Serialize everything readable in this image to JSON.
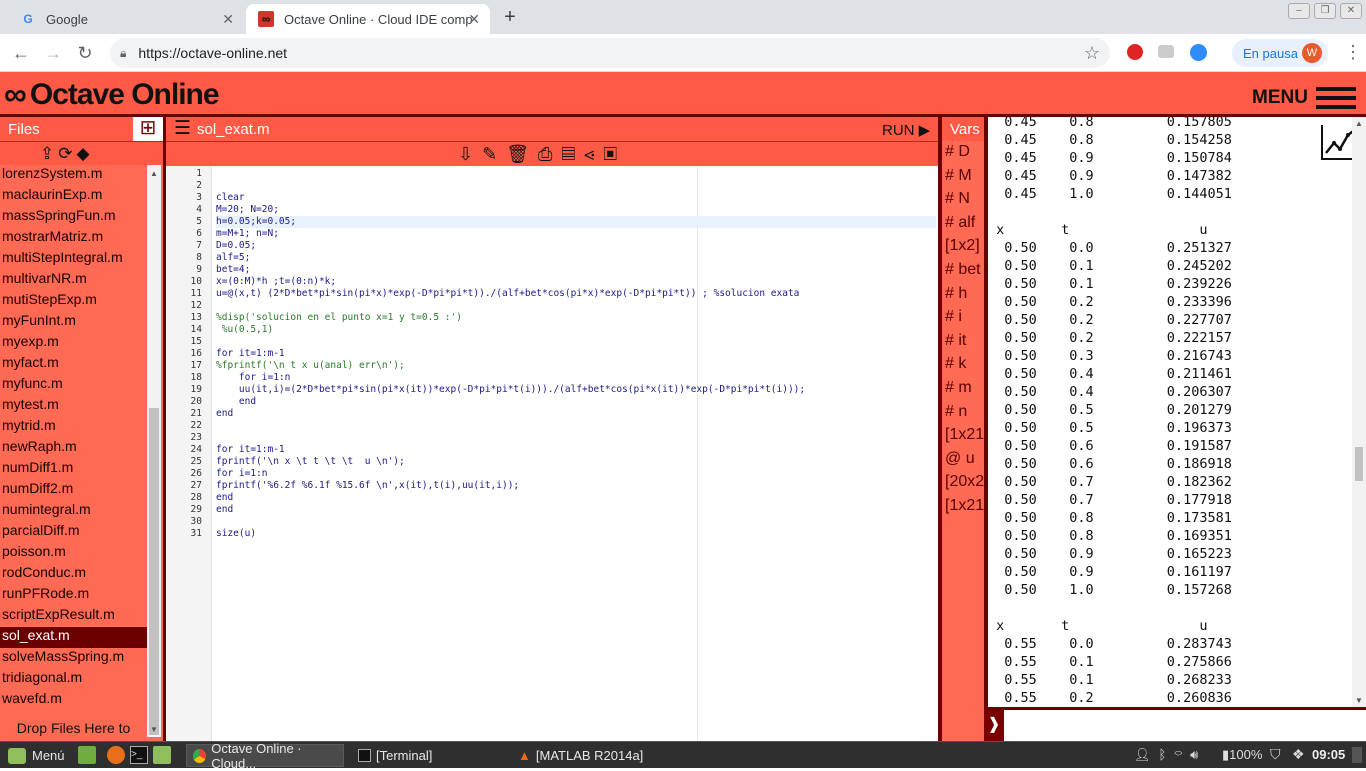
{
  "browser": {
    "tabs": [
      {
        "title": "Google",
        "icon": "google-icon"
      },
      {
        "title": "Octave Online · Cloud IDE comp",
        "icon": "octave-icon"
      }
    ],
    "url": "https://octave-online.net",
    "profile_status": "En pausa",
    "profile_initial": "W"
  },
  "app": {
    "logo": "Octave Online",
    "menu_label": "MENU"
  },
  "files": {
    "header": "Files",
    "items": [
      "lorenzSystem.m",
      "maclaurinExp.m",
      "massSpringFun.m",
      "mostrarMatriz.m",
      "multiStepIntegral.m",
      "multivarNR.m",
      "mutiStepExp.m",
      "myFunInt.m",
      "myexp.m",
      "myfact.m",
      "myfunc.m",
      "mytest.m",
      "mytrid.m",
      "newRaph.m",
      "numDiff1.m",
      "numDiff2.m",
      "numintegral.m",
      "parcialDiff.m",
      "poisson.m",
      "rodConduc.m",
      "runPFRode.m",
      "scriptExpResult.m",
      "sol_exat.m",
      "solveMassSpring.m",
      "tridiagonal.m",
      "wavefd.m"
    ],
    "selected": "sol_exat.m",
    "drop_text": "Drop Files Here to"
  },
  "editor": {
    "filename": "sol_exat.m",
    "run_label": "RUN ▶",
    "lines": [
      "",
      "",
      "clear",
      "M=20; N=20;",
      "h=0.05;k=0.05;",
      "m=M+1; n=N;",
      "D=0.05;",
      "alf=5;",
      "bet=4;",
      "x=(0:M)*h ;t=(0:n)*k;",
      "u=@(x,t) (2*D*bet*pi*sin(pi*x)*exp(-D*pi*pi*t))./(alf+bet*cos(pi*x)*exp(-D*pi*pi*t)) ; %solucion exata",
      "",
      "%disp('solucion en el punto x=1 y t=0.5 :')",
      " %u(0.5,1)",
      "",
      "for it=1:m-1",
      "%fprintf('\\n t x u(anal) err\\n');",
      "    for i=1:n",
      "    uu(it,i)=(2*D*bet*pi*sin(pi*x(it))*exp(-D*pi*pi*t(i)))./(alf+bet*cos(pi*x(it))*exp(-D*pi*pi*t(i)));",
      "    end",
      "end",
      "",
      "",
      "for it=1:m-1",
      "fprintf('\\n x \\t t \\t \\t  u \\n');",
      "for i=1:n",
      "fprintf('%6.2f %6.1f %15.6f \\n',x(it),t(i),uu(it,i));",
      "end",
      "end",
      "",
      "size(u)"
    ]
  },
  "vars": {
    "header": "Vars",
    "items": [
      "# D",
      "# M",
      "# N",
      "# alf",
      "[1x2]",
      "# bet",
      "# h",
      "# i",
      "# it",
      "# k",
      "# m",
      "# n",
      "[1x21",
      "@ u",
      "[20x2",
      "[1x21"
    ]
  },
  "console": {
    "lines": [
      "  0.45    0.8         0.157805",
      "  0.45    0.8         0.154258",
      "  0.45    0.9         0.150784",
      "  0.45    0.9         0.147382",
      "  0.45    1.0         0.144051",
      "",
      " x       t                u",
      "  0.50    0.0         0.251327",
      "  0.50    0.1         0.245202",
      "  0.50    0.1         0.239226",
      "  0.50    0.2         0.233396",
      "  0.50    0.2         0.227707",
      "  0.50    0.2         0.222157",
      "  0.50    0.3         0.216743",
      "  0.50    0.4         0.211461",
      "  0.50    0.4         0.206307",
      "  0.50    0.5         0.201279",
      "  0.50    0.5         0.196373",
      "  0.50    0.6         0.191587",
      "  0.50    0.6         0.186918",
      "  0.50    0.7         0.182362",
      "  0.50    0.7         0.177918",
      "  0.50    0.8         0.173581",
      "  0.50    0.8         0.169351",
      "  0.50    0.9         0.165223",
      "  0.50    0.9         0.161197",
      "  0.50    1.0         0.157268",
      "",
      " x       t                u",
      "  0.55    0.0         0.283743",
      "  0.55    0.1         0.275866",
      "  0.55    0.1         0.268233",
      "  0.55    0.2         0.260836"
    ],
    "prompt_symbol": "❱"
  },
  "taskbar": {
    "menu": "Menú",
    "windows": [
      "Octave Online · Cloud...",
      "[Terminal]",
      "[MATLAB R2014a]"
    ],
    "battery": "100%",
    "time": "09:05"
  },
  "colors": {
    "accent": "#ff5a45",
    "dark": "#6b0000",
    "panel": "#ff6a55"
  }
}
